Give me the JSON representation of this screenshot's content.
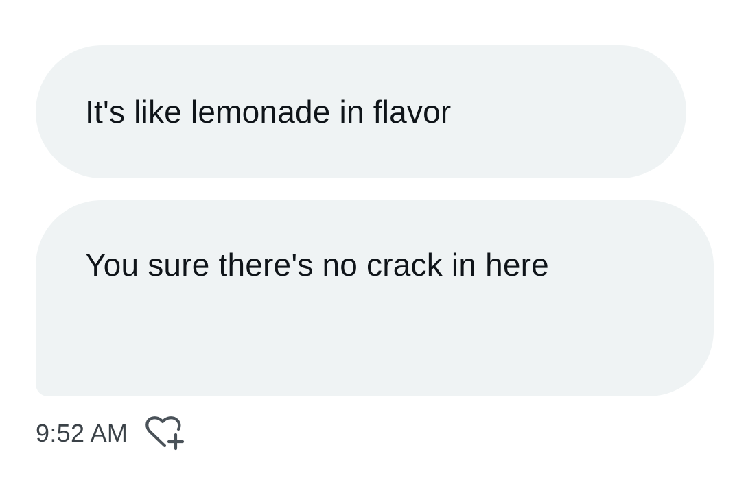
{
  "messages": [
    {
      "text": "It's like lemonade in flavor"
    },
    {
      "text": "You sure there's no crack in here"
    }
  ],
  "timestamp": "9:52 AM",
  "icons": {
    "react": "heart-plus-icon"
  },
  "colors": {
    "bubble_bg": "#eff3f4",
    "text": "#0f1419",
    "muted": "#3b4248"
  }
}
